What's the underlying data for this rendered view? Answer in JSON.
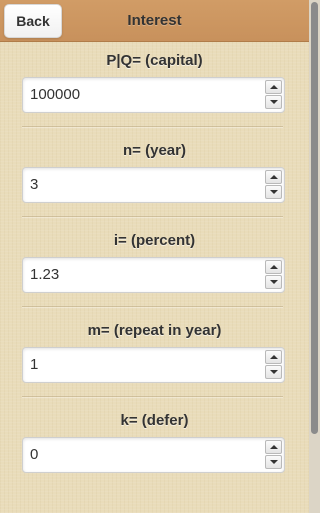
{
  "header": {
    "back_label": "Back",
    "title": "Interest"
  },
  "fields": [
    {
      "label": "P|Q= (capital)",
      "value": "100000"
    },
    {
      "label": "n= (year)",
      "value": "3"
    },
    {
      "label": "i= (percent)",
      "value": "1.23"
    },
    {
      "label": "m= (repeat in year)",
      "value": "1"
    },
    {
      "label": "k= (defer)",
      "value": "0"
    }
  ],
  "colors": {
    "header": "#d19c66",
    "background": "#e9dcba"
  }
}
